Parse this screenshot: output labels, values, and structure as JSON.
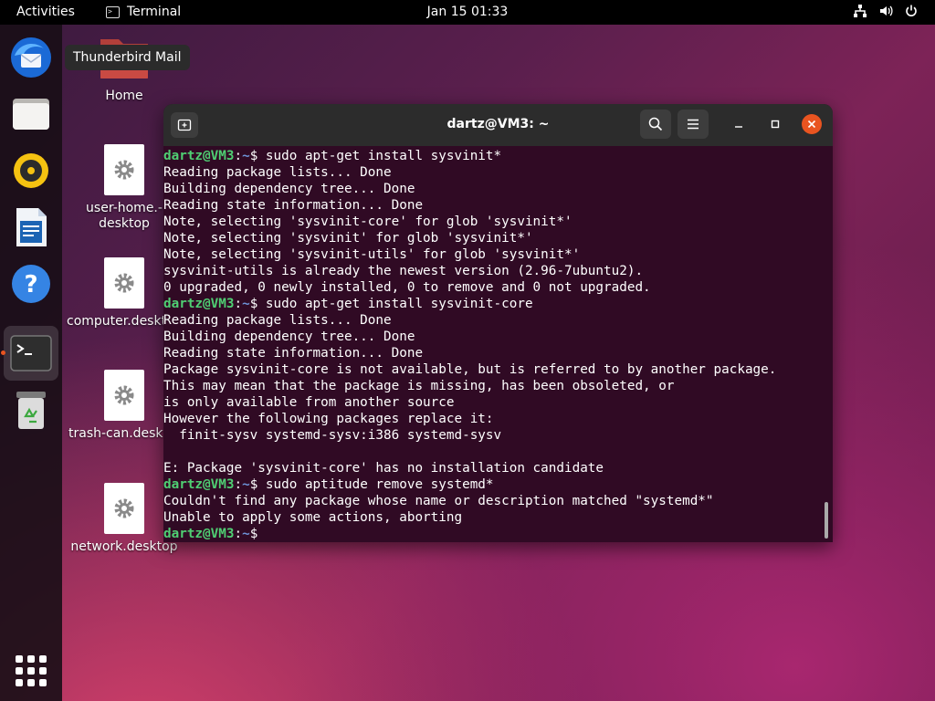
{
  "topbar": {
    "activities": "Activities",
    "app_name": "Terminal",
    "clock": "Jan 15  01:33",
    "tray_icons": [
      "network-icon",
      "volume-icon",
      "power-icon"
    ]
  },
  "tooltip": "Thunderbird Mail",
  "dock": {
    "items": [
      "thunderbird-icon",
      "files-icon",
      "rhythmbox-icon",
      "libreoffice-writer-icon",
      "help-icon",
      "terminal-icon",
      "trash-icon"
    ],
    "running": "terminal-icon",
    "apps_grid": "show-applications-icon"
  },
  "desktop": {
    "icons": [
      {
        "label": "Home",
        "kind": "folder-icon"
      },
      {
        "label": "user-home.­\ndesktop",
        "kind": "gear-icon"
      },
      {
        "label": "computer.deskt",
        "kind": "gear-icon"
      },
      {
        "label": "trash-can.deskt",
        "kind": "gear-icon"
      },
      {
        "label": "network.desktop",
        "kind": "gear-icon"
      }
    ]
  },
  "terminal": {
    "title": "dartz@VM3: ~",
    "prompt_user": "dartz@VM3",
    "prompt_path": "~",
    "lines": [
      {
        "prompt": true,
        "text": "$ sudo apt-get install sysvinit*"
      },
      {
        "prompt": false,
        "text": "Reading package lists... Done"
      },
      {
        "prompt": false,
        "text": "Building dependency tree... Done"
      },
      {
        "prompt": false,
        "text": "Reading state information... Done"
      },
      {
        "prompt": false,
        "text": "Note, selecting 'sysvinit-core' for glob 'sysvinit*'"
      },
      {
        "prompt": false,
        "text": "Note, selecting 'sysvinit' for glob 'sysvinit*'"
      },
      {
        "prompt": false,
        "text": "Note, selecting 'sysvinit-utils' for glob 'sysvinit*'"
      },
      {
        "prompt": false,
        "text": "sysvinit-utils is already the newest version (2.96-7ubuntu2)."
      },
      {
        "prompt": false,
        "text": "0 upgraded, 0 newly installed, 0 to remove and 0 not upgraded."
      },
      {
        "prompt": true,
        "text": "$ sudo apt-get install sysvinit-core"
      },
      {
        "prompt": false,
        "text": "Reading package lists... Done"
      },
      {
        "prompt": false,
        "text": "Building dependency tree... Done"
      },
      {
        "prompt": false,
        "text": "Reading state information... Done"
      },
      {
        "prompt": false,
        "text": "Package sysvinit-core is not available, but is referred to by another package."
      },
      {
        "prompt": false,
        "text": "This may mean that the package is missing, has been obsoleted, or"
      },
      {
        "prompt": false,
        "text": "is only available from another source"
      },
      {
        "prompt": false,
        "text": "However the following packages replace it:"
      },
      {
        "prompt": false,
        "text": "  finit-sysv systemd-sysv:i386 systemd-sysv"
      },
      {
        "prompt": false,
        "text": ""
      },
      {
        "prompt": false,
        "text": "E: Package 'sysvinit-core' has no installation candidate"
      },
      {
        "prompt": true,
        "text": "$ sudo aptitude remove systemd*"
      },
      {
        "prompt": false,
        "text": "Couldn't find any package whose name or description matched \"systemd*\""
      },
      {
        "prompt": false,
        "text": "Unable to apply some actions, aborting"
      },
      {
        "prompt": true,
        "text": "$ "
      }
    ]
  }
}
